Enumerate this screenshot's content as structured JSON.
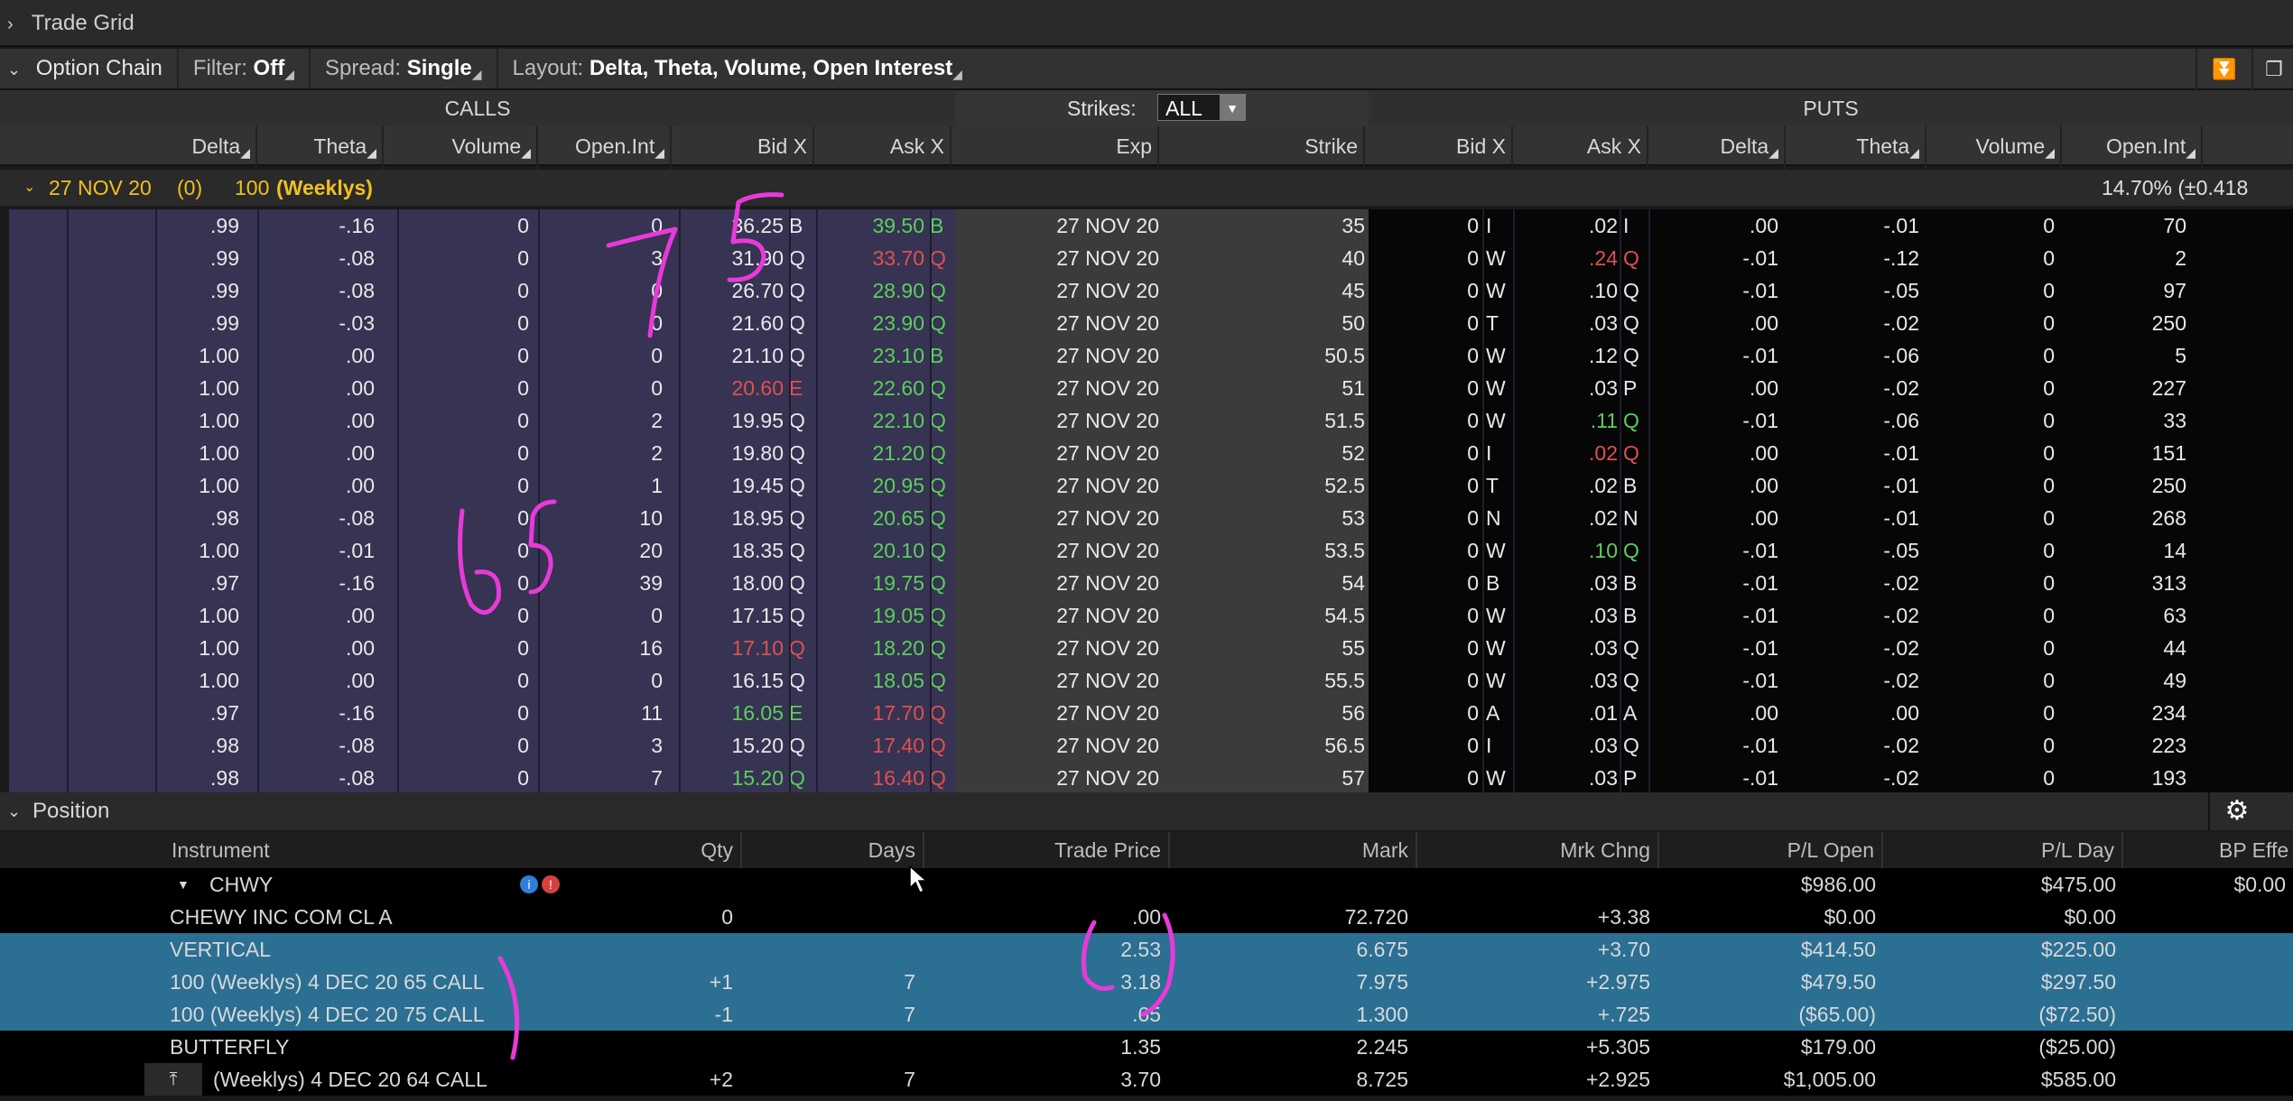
{
  "trade_grid": {
    "title": "Trade Grid"
  },
  "chain_bar": {
    "title": "Option Chain",
    "filter_label": "Filter:",
    "filter_value": "Off",
    "spread_label": "Spread:",
    "spread_value": "Single",
    "layout_label": "Layout:",
    "layout_value": "Delta, Theta, Volume, Open Interest"
  },
  "chain": {
    "calls_label": "CALLS",
    "puts_label": "PUTS",
    "strikes_label": "Strikes:",
    "strikes_value": "ALL",
    "call_headers": [
      "Delta",
      "Theta",
      "Volume",
      "Open.Int",
      "Bid X",
      "Ask X"
    ],
    "mid_headers": [
      "Exp",
      "Strike"
    ],
    "put_headers": [
      "Bid X",
      "Ask X",
      "Delta",
      "Theta",
      "Volume",
      "Open.Int"
    ],
    "expiry": {
      "date": "27 NOV 20",
      "count": "(0)",
      "mult": "100",
      "series": "(Weeklys)",
      "iv": "14.70% (±0.418"
    },
    "rows": [
      {
        "c_delta": ".99",
        "c_theta": "-.16",
        "c_vol": "0",
        "c_oi": "0",
        "c_bid": "36.25",
        "c_bx": "B",
        "c_ask": "39.50",
        "c_ax": "B",
        "exp": "27 NOV 20",
        "strike": "35",
        "p_bid": "0",
        "p_bx": "I",
        "p_ask": ".02",
        "p_ax": "I",
        "p_delta": ".00",
        "p_theta": "-.01",
        "p_vol": "0",
        "p_oi": "70"
      },
      {
        "c_delta": ".99",
        "c_theta": "-.08",
        "c_vol": "0",
        "c_oi": "3",
        "c_bid": "31.90",
        "c_bx": "Q",
        "c_ask": "33.70",
        "c_ax": "Q",
        "exp": "27 NOV 20",
        "strike": "40",
        "p_bid": "0",
        "p_bx": "W",
        "p_ask": ".24",
        "p_ax": "Q",
        "p_delta": "-.01",
        "p_theta": "-.12",
        "p_vol": "0",
        "p_oi": "2"
      },
      {
        "c_delta": ".99",
        "c_theta": "-.08",
        "c_vol": "0",
        "c_oi": "0",
        "c_bid": "26.70",
        "c_bx": "Q",
        "c_ask": "28.90",
        "c_ax": "Q",
        "exp": "27 NOV 20",
        "strike": "45",
        "p_bid": "0",
        "p_bx": "W",
        "p_ask": ".10",
        "p_ax": "Q",
        "p_delta": "-.01",
        "p_theta": "-.05",
        "p_vol": "0",
        "p_oi": "97"
      },
      {
        "c_delta": ".99",
        "c_theta": "-.03",
        "c_vol": "0",
        "c_oi": "0",
        "c_bid": "21.60",
        "c_bx": "Q",
        "c_ask": "23.90",
        "c_ax": "Q",
        "exp": "27 NOV 20",
        "strike": "50",
        "p_bid": "0",
        "p_bx": "T",
        "p_ask": ".03",
        "p_ax": "Q",
        "p_delta": ".00",
        "p_theta": "-.02",
        "p_vol": "0",
        "p_oi": "250"
      },
      {
        "c_delta": "1.00",
        "c_theta": ".00",
        "c_vol": "0",
        "c_oi": "0",
        "c_bid": "21.10",
        "c_bx": "Q",
        "c_ask": "23.10",
        "c_ax": "B",
        "exp": "27 NOV 20",
        "strike": "50.5",
        "p_bid": "0",
        "p_bx": "W",
        "p_ask": ".12",
        "p_ax": "Q",
        "p_delta": "-.01",
        "p_theta": "-.06",
        "p_vol": "0",
        "p_oi": "5"
      },
      {
        "c_delta": "1.00",
        "c_theta": ".00",
        "c_vol": "0",
        "c_oi": "0",
        "c_bid": "20.60",
        "c_bx": "E",
        "c_ask": "22.60",
        "c_ax": "Q",
        "exp": "27 NOV 20",
        "strike": "51",
        "p_bid": "0",
        "p_bx": "W",
        "p_ask": ".03",
        "p_ax": "P",
        "p_delta": ".00",
        "p_theta": "-.02",
        "p_vol": "0",
        "p_oi": "227"
      },
      {
        "c_delta": "1.00",
        "c_theta": ".00",
        "c_vol": "0",
        "c_oi": "2",
        "c_bid": "19.95",
        "c_bx": "Q",
        "c_ask": "22.10",
        "c_ax": "Q",
        "exp": "27 NOV 20",
        "strike": "51.5",
        "p_bid": "0",
        "p_bx": "W",
        "p_ask": ".11",
        "p_ax": "Q",
        "p_delta": "-.01",
        "p_theta": "-.06",
        "p_vol": "0",
        "p_oi": "33"
      },
      {
        "c_delta": "1.00",
        "c_theta": ".00",
        "c_vol": "0",
        "c_oi": "2",
        "c_bid": "19.80",
        "c_bx": "Q",
        "c_ask": "21.20",
        "c_ax": "Q",
        "exp": "27 NOV 20",
        "strike": "52",
        "p_bid": "0",
        "p_bx": "I",
        "p_ask": ".02",
        "p_ax": "Q",
        "p_delta": ".00",
        "p_theta": "-.01",
        "p_vol": "0",
        "p_oi": "151"
      },
      {
        "c_delta": "1.00",
        "c_theta": ".00",
        "c_vol": "0",
        "c_oi": "1",
        "c_bid": "19.45",
        "c_bx": "Q",
        "c_ask": "20.95",
        "c_ax": "Q",
        "exp": "27 NOV 20",
        "strike": "52.5",
        "p_bid": "0",
        "p_bx": "T",
        "p_ask": ".02",
        "p_ax": "B",
        "p_delta": ".00",
        "p_theta": "-.01",
        "p_vol": "0",
        "p_oi": "250"
      },
      {
        "c_delta": ".98",
        "c_theta": "-.08",
        "c_vol": "0",
        "c_oi": "10",
        "c_bid": "18.95",
        "c_bx": "Q",
        "c_ask": "20.65",
        "c_ax": "Q",
        "exp": "27 NOV 20",
        "strike": "53",
        "p_bid": "0",
        "p_bx": "N",
        "p_ask": ".02",
        "p_ax": "N",
        "p_delta": ".00",
        "p_theta": "-.01",
        "p_vol": "0",
        "p_oi": "268"
      },
      {
        "c_delta": "1.00",
        "c_theta": "-.01",
        "c_vol": "0",
        "c_oi": "20",
        "c_bid": "18.35",
        "c_bx": "Q",
        "c_ask": "20.10",
        "c_ax": "Q",
        "exp": "27 NOV 20",
        "strike": "53.5",
        "p_bid": "0",
        "p_bx": "W",
        "p_ask": ".10",
        "p_ax": "Q",
        "p_delta": "-.01",
        "p_theta": "-.05",
        "p_vol": "0",
        "p_oi": "14"
      },
      {
        "c_delta": ".97",
        "c_theta": "-.16",
        "c_vol": "0",
        "c_oi": "39",
        "c_bid": "18.00",
        "c_bx": "Q",
        "c_ask": "19.75",
        "c_ax": "Q",
        "exp": "27 NOV 20",
        "strike": "54",
        "p_bid": "0",
        "p_bx": "B",
        "p_ask": ".03",
        "p_ax": "B",
        "p_delta": "-.01",
        "p_theta": "-.02",
        "p_vol": "0",
        "p_oi": "313"
      },
      {
        "c_delta": "1.00",
        "c_theta": ".00",
        "c_vol": "0",
        "c_oi": "0",
        "c_bid": "17.15",
        "c_bx": "Q",
        "c_ask": "19.05",
        "c_ax": "Q",
        "exp": "27 NOV 20",
        "strike": "54.5",
        "p_bid": "0",
        "p_bx": "W",
        "p_ask": ".03",
        "p_ax": "B",
        "p_delta": "-.01",
        "p_theta": "-.02",
        "p_vol": "0",
        "p_oi": "63"
      },
      {
        "c_delta": "1.00",
        "c_theta": ".00",
        "c_vol": "0",
        "c_oi": "16",
        "c_bid": "17.10",
        "c_bx": "Q",
        "c_ask": "18.20",
        "c_ax": "Q",
        "exp": "27 NOV 20",
        "strike": "55",
        "p_bid": "0",
        "p_bx": "W",
        "p_ask": ".03",
        "p_ax": "Q",
        "p_delta": "-.01",
        "p_theta": "-.02",
        "p_vol": "0",
        "p_oi": "44"
      },
      {
        "c_delta": "1.00",
        "c_theta": ".00",
        "c_vol": "0",
        "c_oi": "0",
        "c_bid": "16.15",
        "c_bx": "Q",
        "c_ask": "18.05",
        "c_ax": "Q",
        "exp": "27 NOV 20",
        "strike": "55.5",
        "p_bid": "0",
        "p_bx": "W",
        "p_ask": ".03",
        "p_ax": "Q",
        "p_delta": "-.01",
        "p_theta": "-.02",
        "p_vol": "0",
        "p_oi": "49"
      },
      {
        "c_delta": ".97",
        "c_theta": "-.16",
        "c_vol": "0",
        "c_oi": "11",
        "c_bid": "16.05",
        "c_bx": "E",
        "c_ask": "17.70",
        "c_ax": "Q",
        "exp": "27 NOV 20",
        "strike": "56",
        "p_bid": "0",
        "p_bx": "A",
        "p_ask": ".01",
        "p_ax": "A",
        "p_delta": ".00",
        "p_theta": ".00",
        "p_vol": "0",
        "p_oi": "234"
      },
      {
        "c_delta": ".98",
        "c_theta": "-.08",
        "c_vol": "0",
        "c_oi": "3",
        "c_bid": "15.20",
        "c_bx": "Q",
        "c_ask": "17.40",
        "c_ax": "Q",
        "exp": "27 NOV 20",
        "strike": "56.5",
        "p_bid": "0",
        "p_bx": "I",
        "p_ask": ".03",
        "p_ax": "Q",
        "p_delta": "-.01",
        "p_theta": "-.02",
        "p_vol": "0",
        "p_oi": "223"
      },
      {
        "c_delta": ".98",
        "c_theta": "-.08",
        "c_vol": "0",
        "c_oi": "7",
        "c_bid": "15.20",
        "c_bx": "Q",
        "c_ask": "16.40",
        "c_ax": "Q",
        "exp": "27 NOV 20",
        "strike": "57",
        "p_bid": "0",
        "p_bx": "W",
        "p_ask": ".03",
        "p_ax": "P",
        "p_delta": "-.01",
        "p_theta": "-.02",
        "p_vol": "0",
        "p_oi": "193"
      }
    ]
  },
  "colors": {
    "call_bg": "#363353",
    "put_bg": "#060606",
    "green": "#5ccf5c",
    "red": "#e05050",
    "highlight": "#2b6f93",
    "expiry_yellow": "#f0c020",
    "ink": "#e83ad8"
  },
  "position": {
    "title": "Position",
    "headers": [
      "Instrument",
      "Qty",
      "Days",
      "Trade Price",
      "Mark",
      "Mrk Chng",
      "P/L Open",
      "P/L Day",
      "BP Effe"
    ],
    "group": {
      "symbol": "CHWY",
      "pl_open": "$986.00",
      "pl_day": "$475.00",
      "bp": "$0.00"
    },
    "rows": [
      {
        "instrument": "CHEWY INC COM CL A",
        "qty": "0",
        "days": "",
        "trade": ".00",
        "mark": "72.720",
        "chng": "+3.38",
        "plopen": "$0.00",
        "plday": "$0.00",
        "hl": false,
        "indent": false
      },
      {
        "instrument": "VERTICAL",
        "qty": "",
        "days": "",
        "trade": "2.53",
        "mark": "6.675",
        "chng": "+3.70",
        "plopen": "$414.50",
        "plday": "$225.00",
        "hl": true,
        "indent": false
      },
      {
        "instrument": "100 (Weeklys) 4 DEC 20 65 CALL",
        "qty": "+1",
        "days": "7",
        "trade": "3.18",
        "mark": "7.975",
        "chng": "+2.975",
        "plopen": "$479.50",
        "plday": "$297.50",
        "hl": true,
        "indent": false
      },
      {
        "instrument": "100 (Weeklys) 4 DEC 20 75 CALL",
        "qty": "-1",
        "days": "7",
        "trade": ".65",
        "mark": "1.300",
        "chng": "+.725",
        "plopen": "($65.00)",
        "plday": "($72.50)",
        "hl": true,
        "indent": false
      },
      {
        "instrument": "BUTTERFLY",
        "qty": "",
        "days": "",
        "trade": "1.35",
        "mark": "2.245",
        "chng": "+5.305",
        "plopen": "$179.00",
        "plday": "($25.00)",
        "hl": false,
        "indent": false
      },
      {
        "instrument": "(Weeklys) 4 DEC 20 64 CALL",
        "qty": "+2",
        "days": "7",
        "trade": "3.70",
        "mark": "8.725",
        "chng": "+2.925",
        "plopen": "$1,005.00",
        "plday": "$585.00",
        "hl": false,
        "indent": true
      }
    ]
  }
}
